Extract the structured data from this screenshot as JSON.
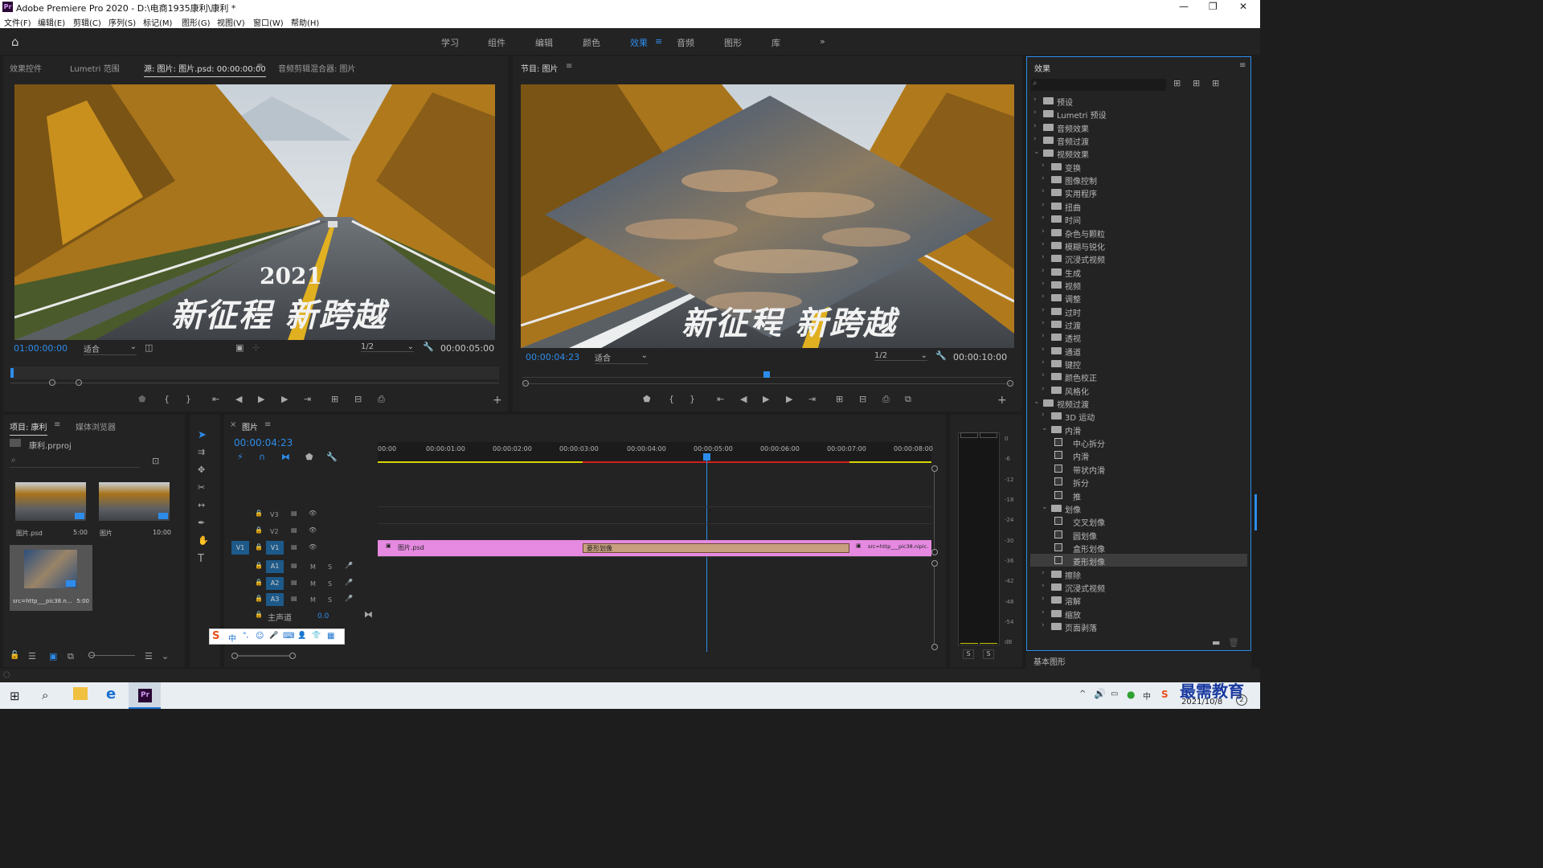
{
  "app": {
    "title": "Adobe Premiere Pro 2020 - D:\\电商1935康利\\康利 *",
    "logo": "Pr"
  },
  "window_controls": {
    "minimize": "—",
    "maximize": "❐",
    "close": "✕"
  },
  "menu": [
    "文件(F)",
    "编辑(E)",
    "剪辑(C)",
    "序列(S)",
    "标记(M)",
    "图形(G)",
    "视图(V)",
    "窗口(W)",
    "帮助(H)"
  ],
  "workspaces": {
    "items": [
      "学习",
      "组件",
      "编辑",
      "颜色",
      "效果",
      "音频",
      "图形",
      "库"
    ],
    "active": "效果",
    "more": "»"
  },
  "source_panel": {
    "tabs": [
      "效果控件",
      "Lumetri 范围",
      "源: 图片: 图片.psd: 00:00:00:00",
      "音频剪辑混合器: 图片"
    ],
    "active_tab": "源: 图片: 图片.psd: 00:00:00:00",
    "overlay_year": "2021",
    "overlay_text": "新征程 新跨越",
    "timecode": "01:00:00:00",
    "fit": "适合",
    "resolution": "1/2",
    "duration": "00:00:05:00"
  },
  "program_panel": {
    "title": "节目: 图片",
    "overlay_text": "新征程 新跨越",
    "timecode": "00:00:04:23",
    "fit": "适合",
    "resolution": "1/2",
    "duration": "00:00:10:00",
    "playhead_fraction": 0.5
  },
  "project_panel": {
    "tabs": [
      "项目: 康利",
      "媒体浏览器"
    ],
    "project_file": "康利.prproj",
    "items": [
      {
        "name": "图片.psd",
        "duration": "5:00"
      },
      {
        "name": "图片",
        "duration": "10:00"
      },
      {
        "name": "src=http___pic38.n...",
        "duration": "5:00"
      }
    ]
  },
  "timeline": {
    "tab": "图片",
    "timecode": "00:00:04:23",
    "ruler": [
      "00:00",
      "00:00:01:00",
      "00:00:02:00",
      "00:00:03:00",
      "00:00:04:00",
      "00:00:05:00",
      "00:00:06:00",
      "00:00:07:00",
      "00:00:08:00"
    ],
    "video_tracks": [
      "V3",
      "V2",
      "V1"
    ],
    "audio_tracks": [
      "A1",
      "A2",
      "A3"
    ],
    "source_patch": "V1",
    "master": {
      "label": "主声道",
      "value": "0.0"
    },
    "clips": {
      "clip1": "图片.psd",
      "transition": "菱形划像",
      "clip2": "src=http___pic38.nipic."
    },
    "track_toggle_m": "M",
    "track_toggle_s": "S"
  },
  "audio_meter": {
    "scale": [
      "0",
      "-6",
      "-12",
      "-18",
      "-24",
      "-30",
      "-36",
      "-42",
      "-48",
      "-54",
      "dB"
    ],
    "buttons": [
      "S",
      "S"
    ]
  },
  "effects_panel": {
    "title": "效果",
    "bottom_tab": "基本图形",
    "tree": [
      {
        "level": 0,
        "type": "folder",
        "arrow": "›",
        "label": "预设"
      },
      {
        "level": 0,
        "type": "folder",
        "arrow": "›",
        "label": "Lumetri 预设"
      },
      {
        "level": 0,
        "type": "folder",
        "arrow": "›",
        "label": "音频效果"
      },
      {
        "level": 0,
        "type": "folder",
        "arrow": "›",
        "label": "音频过渡"
      },
      {
        "level": 0,
        "type": "folder",
        "arrow": "⌄",
        "label": "视频效果"
      },
      {
        "level": 1,
        "type": "folder",
        "arrow": "›",
        "label": "变换"
      },
      {
        "level": 1,
        "type": "folder",
        "arrow": "›",
        "label": "图像控制"
      },
      {
        "level": 1,
        "type": "folder",
        "arrow": "›",
        "label": "实用程序"
      },
      {
        "level": 1,
        "type": "folder",
        "arrow": "›",
        "label": "扭曲"
      },
      {
        "level": 1,
        "type": "folder",
        "arrow": "›",
        "label": "时间"
      },
      {
        "level": 1,
        "type": "folder",
        "arrow": "›",
        "label": "杂色与颗粒"
      },
      {
        "level": 1,
        "type": "folder",
        "arrow": "›",
        "label": "模糊与锐化"
      },
      {
        "level": 1,
        "type": "folder",
        "arrow": "›",
        "label": "沉浸式视频"
      },
      {
        "level": 1,
        "type": "folder",
        "arrow": "›",
        "label": "生成"
      },
      {
        "level": 1,
        "type": "folder",
        "arrow": "›",
        "label": "视频"
      },
      {
        "level": 1,
        "type": "folder",
        "arrow": "›",
        "label": "调整"
      },
      {
        "level": 1,
        "type": "folder",
        "arrow": "›",
        "label": "过时"
      },
      {
        "level": 1,
        "type": "folder",
        "arrow": "›",
        "label": "过渡"
      },
      {
        "level": 1,
        "type": "folder",
        "arrow": "›",
        "label": "透视"
      },
      {
        "level": 1,
        "type": "folder",
        "arrow": "›",
        "label": "通道"
      },
      {
        "level": 1,
        "type": "folder",
        "arrow": "›",
        "label": "键控"
      },
      {
        "level": 1,
        "type": "folder",
        "arrow": "›",
        "label": "颜色校正"
      },
      {
        "level": 1,
        "type": "folder",
        "arrow": "›",
        "label": "风格化"
      },
      {
        "level": 0,
        "type": "folder",
        "arrow": "⌄",
        "label": "视频过渡"
      },
      {
        "level": 1,
        "type": "folder",
        "arrow": "›",
        "label": "3D 运动"
      },
      {
        "level": 1,
        "type": "folder",
        "arrow": "⌄",
        "label": "内滑"
      },
      {
        "level": 2,
        "type": "effect",
        "arrow": "",
        "label": "中心拆分"
      },
      {
        "level": 2,
        "type": "effect",
        "arrow": "",
        "label": "内滑"
      },
      {
        "level": 2,
        "type": "effect",
        "arrow": "",
        "label": "带状内滑"
      },
      {
        "level": 2,
        "type": "effect",
        "arrow": "",
        "label": "拆分"
      },
      {
        "level": 2,
        "type": "effect",
        "arrow": "",
        "label": "推"
      },
      {
        "level": 1,
        "type": "folder",
        "arrow": "⌄",
        "label": "划像"
      },
      {
        "level": 2,
        "type": "effect",
        "arrow": "",
        "label": "交叉划像"
      },
      {
        "level": 2,
        "type": "effect",
        "arrow": "",
        "label": "圆划像"
      },
      {
        "level": 2,
        "type": "effect",
        "arrow": "",
        "label": "盒形划像"
      },
      {
        "level": 2,
        "type": "effect",
        "arrow": "",
        "label": "菱形划像",
        "selected": true
      },
      {
        "level": 1,
        "type": "folder",
        "arrow": "›",
        "label": "擦除"
      },
      {
        "level": 1,
        "type": "folder",
        "arrow": "›",
        "label": "沉浸式视频"
      },
      {
        "level": 1,
        "type": "folder",
        "arrow": "›",
        "label": "溶解"
      },
      {
        "level": 1,
        "type": "folder",
        "arrow": "›",
        "label": "缩放"
      },
      {
        "level": 1,
        "type": "folder",
        "arrow": "›",
        "label": "页面剥落"
      }
    ]
  },
  "ime_toolbar": [
    "S",
    "中",
    "°,",
    "☺",
    "🎤",
    "⌨",
    "👤",
    "👕",
    "▦"
  ],
  "taskbar": {
    "date": "2021/10/8",
    "watermark": "最需教育",
    "notify": "2",
    "tray": [
      "^",
      "🔊",
      "中",
      "S"
    ]
  },
  "colors": {
    "accent": "#2d8ceb",
    "clip": "#e58ae0",
    "transition": "#c8a080",
    "workarea_yellow": "#d6d600",
    "render_red": "#d02020"
  }
}
